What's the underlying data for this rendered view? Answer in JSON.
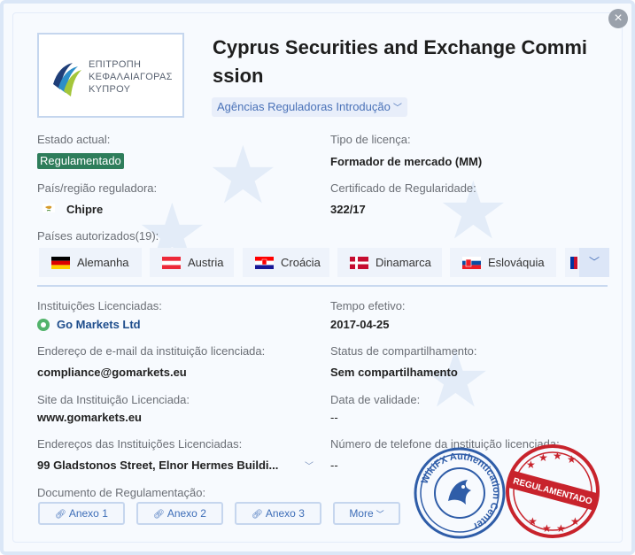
{
  "header": {
    "title": "Cyprus Securities and Exchange Commission",
    "intro_label": "Agências Reguladoras Introdução",
    "logo_lines": [
      "ΕΠΙΤΡΟΠΗ",
      "ΚΕΦΑΛΑΙΑΓΟΡΑΣ",
      "ΚΥΠΡΟΥ"
    ]
  },
  "close_label": "×",
  "fields": {
    "estado_label": "Estado actual:",
    "estado_value": "Regulamentado",
    "licenca_label": "Tipo de licença:",
    "licenca_value": "Formador de mercado (MM)",
    "pais_label": "País/região reguladora:",
    "pais_value": "Chipre",
    "certificado_label": "Certificado de Regularidade:",
    "certificado_value": "322/17",
    "autorizados_label": "Países autorizados(19):"
  },
  "countries": [
    {
      "name": "Alemanha",
      "flag": "germany-flag"
    },
    {
      "name": "Austria",
      "flag": "austria-flag"
    },
    {
      "name": "Croácia",
      "flag": "croatia-flag"
    },
    {
      "name": "Dinamarca",
      "flag": "denmark-flag"
    },
    {
      "name": "Eslováquia",
      "flag": "slovakia-flag"
    }
  ],
  "institution": {
    "inst_label": "Instituições Licenciadas:",
    "inst_value": "Go Markets Ltd",
    "tempo_label": "Tempo efetivo:",
    "tempo_value": "2017-04-25",
    "email_label": "Endereço de e-mail da instituição licenciada:",
    "email_value": "compliance@gomarkets.eu",
    "share_label": "Status de compartilhamento:",
    "share_value": "Sem compartilhamento",
    "site_label": "Site da Instituição Licenciada:",
    "site_value": "www.gomarkets.eu",
    "validade_label": "Data de validade:",
    "validade_value": "--",
    "addr_label": "Endereços das Instituições Licenciadas:",
    "addr_value": "99 Gladstonos Street, Elnor Hermes Buildi...",
    "phone_label": "Número de telefone da instituição licenciada:",
    "phone_value": "--"
  },
  "documents": {
    "label": "Documento de Regulamentação:",
    "items": [
      "Anexo 1",
      "Anexo 2",
      "Anexo 3"
    ],
    "more_label": "More"
  },
  "stamps": {
    "auth_text": "WikiFX Authentication Center",
    "reg_text": "REGULAMENTADO"
  },
  "colors": {
    "accent": "#4a72b8",
    "status_green": "#2e7d5b",
    "stamp_blue": "#2f5da8",
    "stamp_red": "#c8232c"
  }
}
